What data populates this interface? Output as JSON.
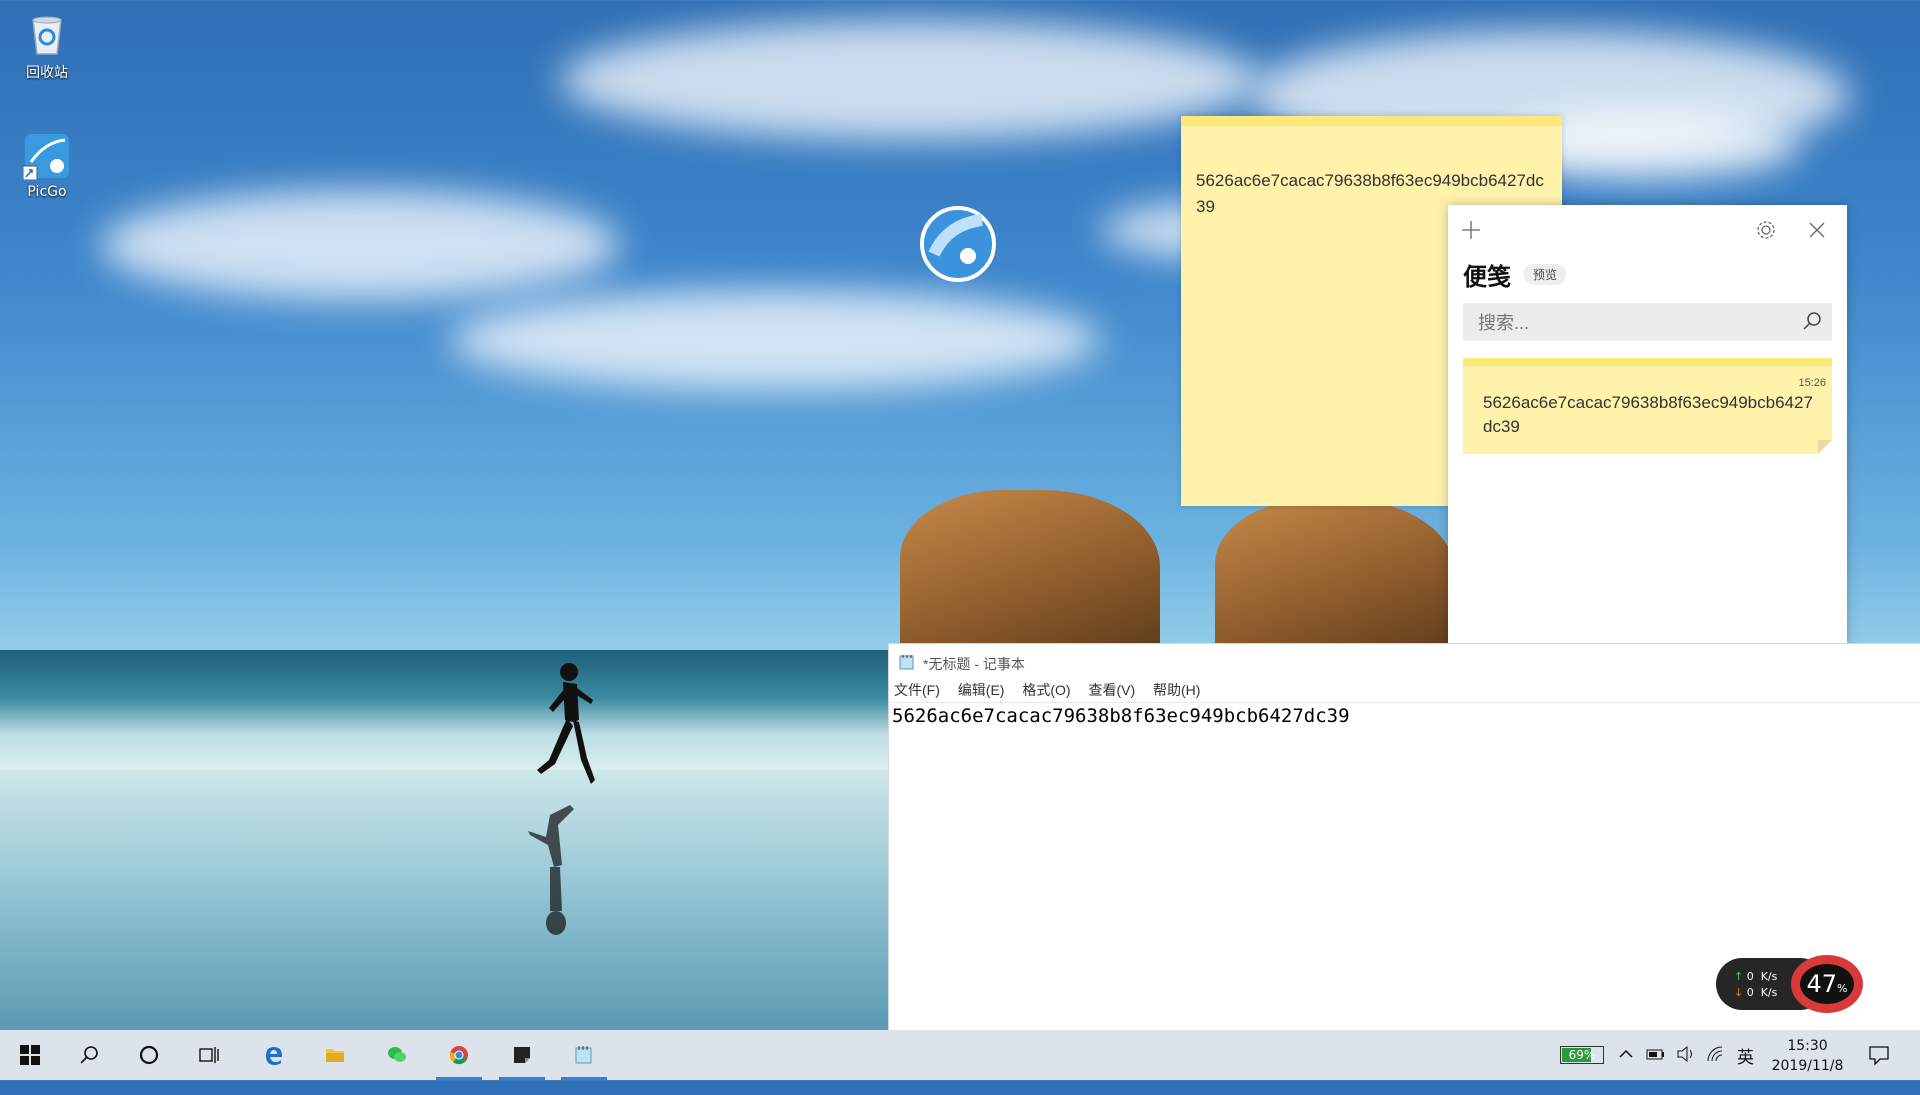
{
  "desktop": {
    "icons": [
      {
        "label": "回收站",
        "icon": "recycle-bin-icon"
      },
      {
        "label": "PicGo",
        "icon": "picgo-icon"
      }
    ]
  },
  "sticky_big": {
    "text": "5626ac6e7cacac79638b8f63ec949bcb6427dc39"
  },
  "notes_panel": {
    "title": "便笺",
    "badge": "预览",
    "search_placeholder": "搜索...",
    "note": {
      "time": "15:26",
      "text": "5626ac6e7cacac79638b8f63ec949bcb6427dc39"
    }
  },
  "notepad": {
    "title": "*无标题 - 记事本",
    "menu": [
      "文件(F)",
      "编辑(E)",
      "格式(O)",
      "查看(V)",
      "帮助(H)"
    ],
    "content": "5626ac6e7cacac79638b8f63ec949bcb6427dc39"
  },
  "net_widget": {
    "up": "0",
    "down": "0",
    "unit": "K/s",
    "cpu_percent": "47",
    "percent_sign": "%"
  },
  "taskbar": {
    "battery": "69%",
    "battery_level": 0.69,
    "ime": "英",
    "time": "15:30",
    "date": "2019/11/8"
  },
  "colors": {
    "sticky": "#fff2ab",
    "sticky_bar": "#fde97a",
    "taskbar": "#dde3ea",
    "accent": "#3d7fcf"
  }
}
